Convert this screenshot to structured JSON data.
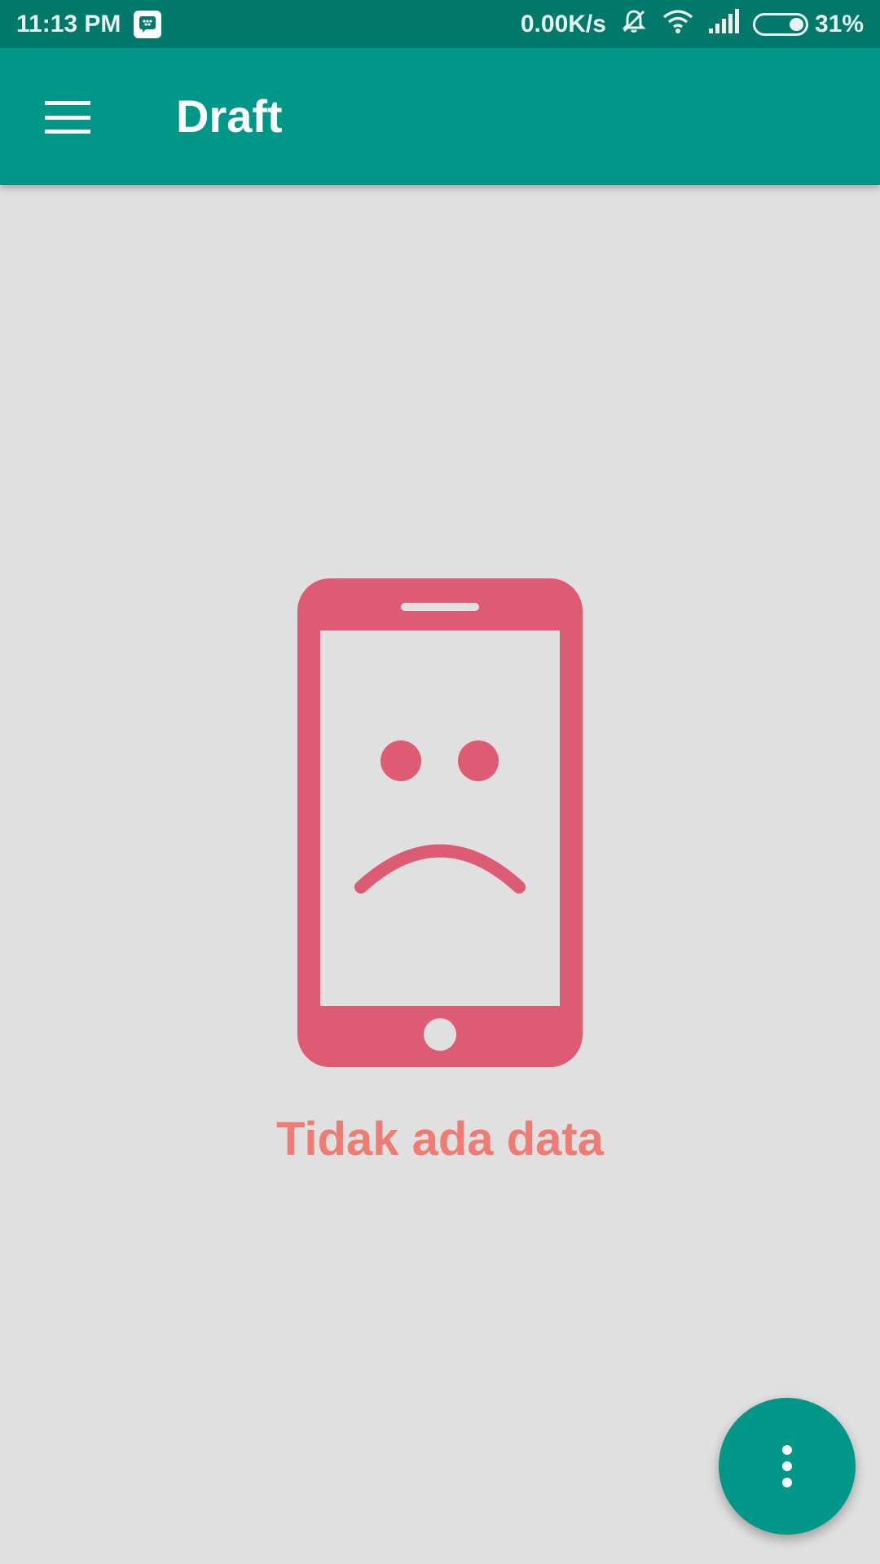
{
  "status_bar": {
    "time": "11:13 PM",
    "network_speed": "0.00K/s",
    "battery_percent": "31%",
    "battery_level": 0.31,
    "icons": [
      "bbm-notification-icon",
      "mute-bell-icon",
      "wifi-icon",
      "signal-icon",
      "battery-icon"
    ]
  },
  "app_bar": {
    "title": "Draft",
    "menu_icon": "hamburger-menu-icon"
  },
  "empty_state": {
    "message": "Tidak ada data",
    "icon": "sad-phone-icon"
  },
  "fab": {
    "icon": "more-vertical-icon"
  },
  "colors": {
    "primary": "#009688",
    "primary_dark": "#00796b",
    "background": "#e0e0e0",
    "illustration": "#de5b74",
    "empty_text": "#ee7c74"
  }
}
